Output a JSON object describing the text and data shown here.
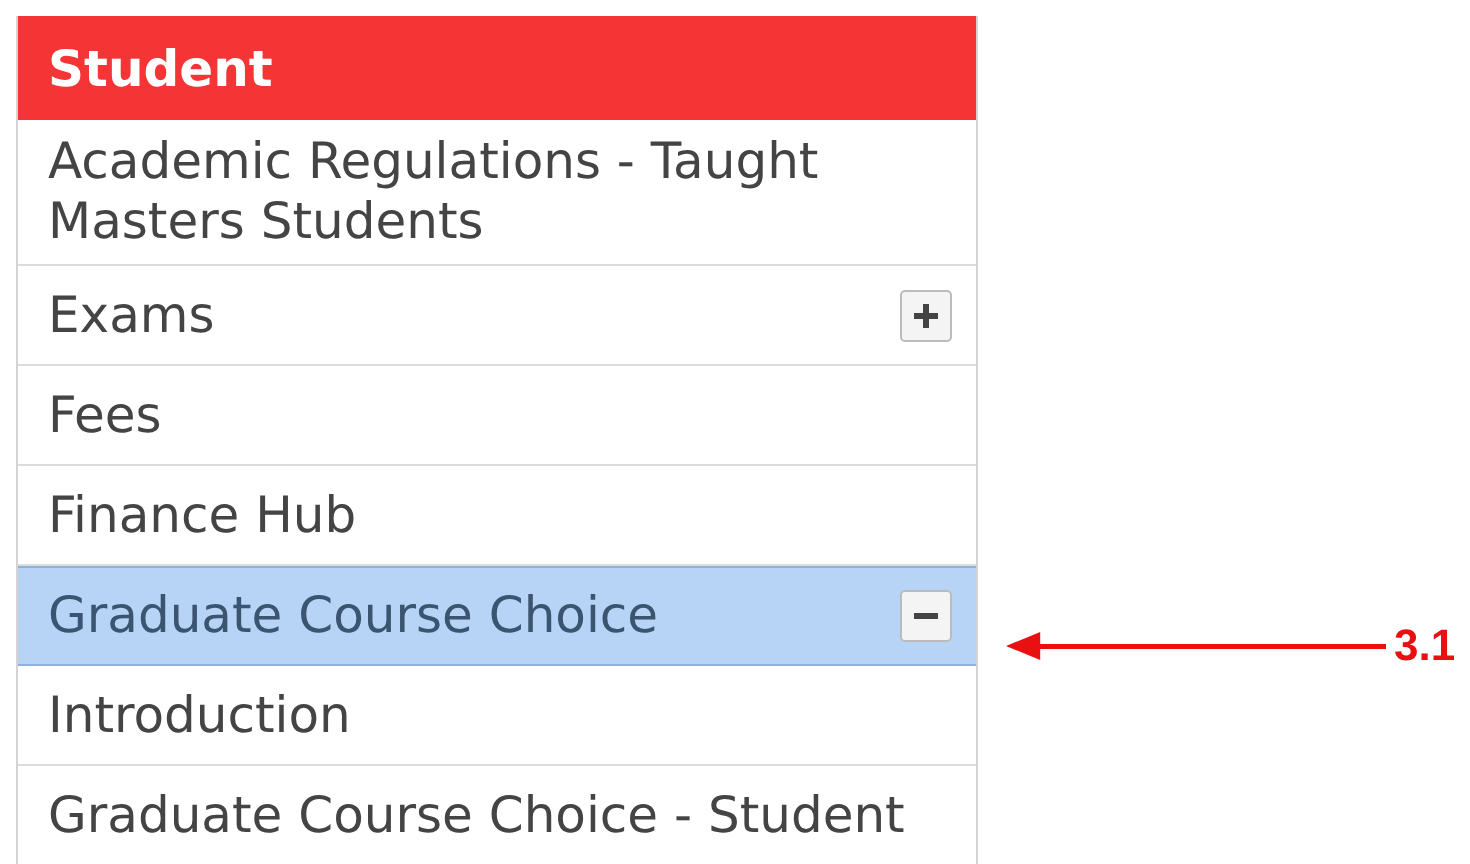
{
  "menu": {
    "title": "Student",
    "items": [
      {
        "label": "Academic Regulations - Taught Masters Students",
        "selected": false
      },
      {
        "label": "Exams",
        "selected": false,
        "expanded": false
      },
      {
        "label": "Fees",
        "selected": false
      },
      {
        "label": "Finance Hub",
        "selected": false
      },
      {
        "label": "Graduate Course Choice",
        "selected": true,
        "expanded": true,
        "children": [
          {
            "label": "Introduction",
            "selected": false
          },
          {
            "label": "Graduate Course Choice - Student",
            "selected": false
          }
        ]
      }
    ]
  },
  "annotation": {
    "label": "3.1"
  }
}
